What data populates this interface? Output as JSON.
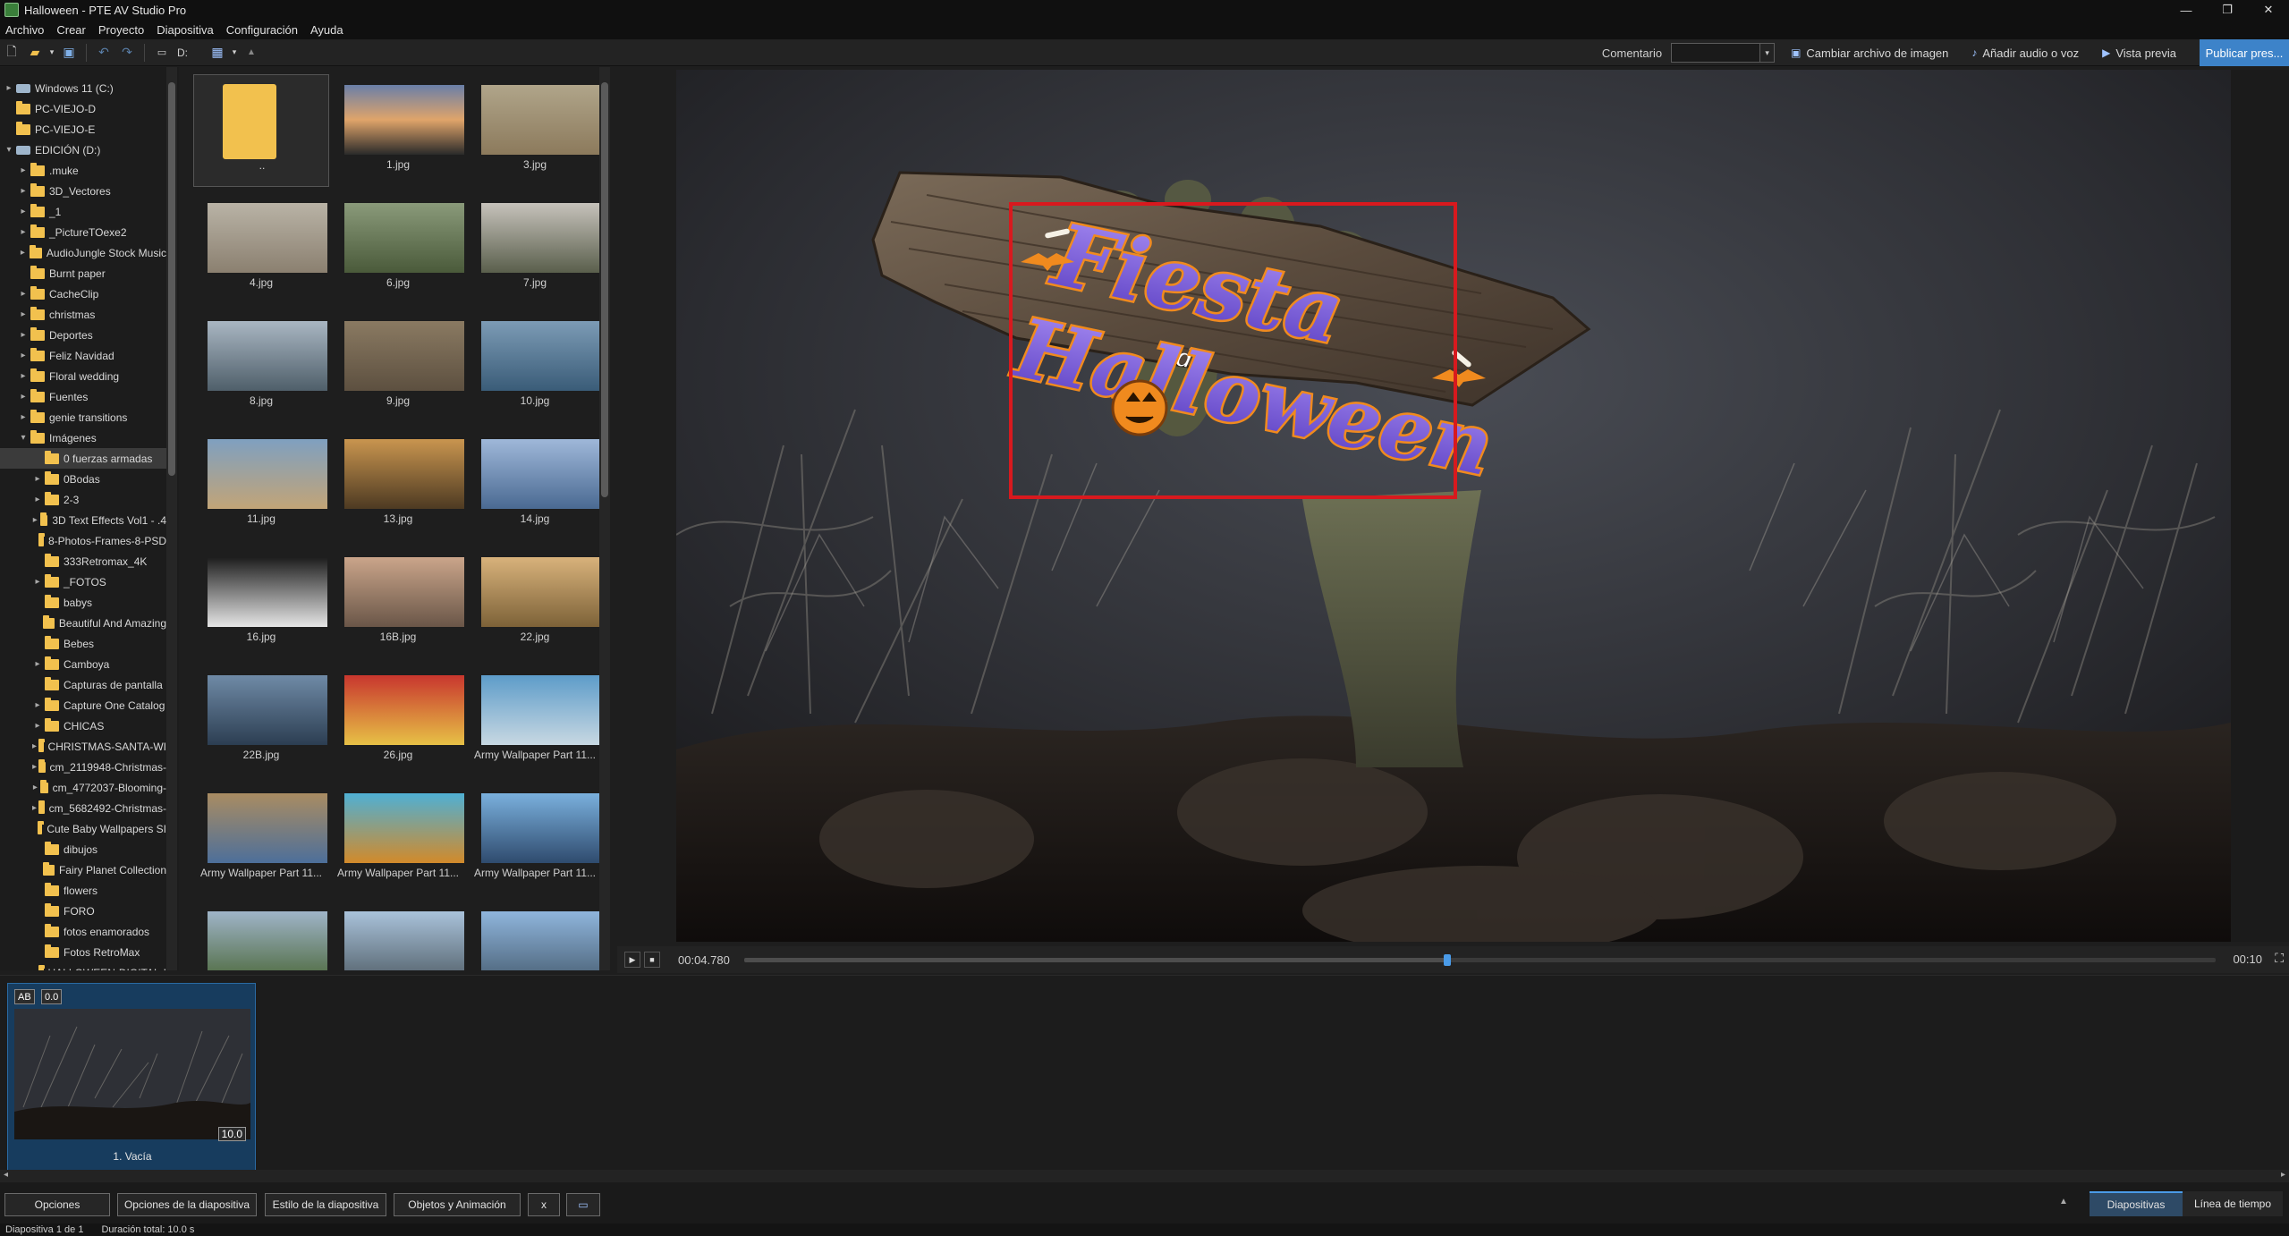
{
  "window": {
    "title": "Halloween - PTE AV Studio Pro"
  },
  "menu": [
    "Archivo",
    "Crear",
    "Proyecto",
    "Diapositiva",
    "Configuración",
    "Ayuda"
  ],
  "toolbar": {
    "drive_label": "D:",
    "comment_label": "Comentario",
    "comment_value": "",
    "change_image_label": "Cambiar archivo de imagen",
    "add_audio_label": "Añadir audio o voz",
    "preview_label": "Vista previa",
    "publish_label": "Publicar pres..."
  },
  "tree": [
    {
      "label": "Windows 11 (C:)",
      "type": "drive",
      "level": 0,
      "arrow": "▸"
    },
    {
      "label": "PC-VIEJO-D",
      "type": "folder",
      "level": 0,
      "arrow": ""
    },
    {
      "label": "PC-VIEJO-E",
      "type": "folder",
      "level": 0,
      "arrow": ""
    },
    {
      "label": "EDICIÓN (D:)",
      "type": "drive",
      "level": 0,
      "arrow": "▾"
    },
    {
      "label": ".muke",
      "type": "folder",
      "level": 1,
      "arrow": "▸"
    },
    {
      "label": "3D_Vectores",
      "type": "folder",
      "level": 1,
      "arrow": "▸"
    },
    {
      "label": "_1",
      "type": "folder",
      "level": 1,
      "arrow": "▸"
    },
    {
      "label": "_PictureTOexe2",
      "type": "folder",
      "level": 1,
      "arrow": "▸"
    },
    {
      "label": "AudioJungle Stock Music",
      "type": "folder",
      "level": 1,
      "arrow": "▸"
    },
    {
      "label": "Burnt paper",
      "type": "folder",
      "level": 1,
      "arrow": ""
    },
    {
      "label": "CacheClip",
      "type": "folder",
      "level": 1,
      "arrow": "▸"
    },
    {
      "label": "christmas",
      "type": "folder",
      "level": 1,
      "arrow": "▸"
    },
    {
      "label": "Deportes",
      "type": "folder",
      "level": 1,
      "arrow": "▸"
    },
    {
      "label": "Feliz Navidad",
      "type": "folder",
      "level": 1,
      "arrow": "▸"
    },
    {
      "label": "Floral wedding",
      "type": "folder",
      "level": 1,
      "arrow": "▸"
    },
    {
      "label": "Fuentes",
      "type": "folder",
      "level": 1,
      "arrow": "▸"
    },
    {
      "label": "genie transitions",
      "type": "folder",
      "level": 1,
      "arrow": "▸"
    },
    {
      "label": "Imágenes",
      "type": "folder",
      "level": 1,
      "arrow": "▾"
    },
    {
      "label": "0 fuerzas armadas",
      "type": "folder",
      "level": 2,
      "arrow": "",
      "selected": true
    },
    {
      "label": "0Bodas",
      "type": "folder",
      "level": 2,
      "arrow": "▸"
    },
    {
      "label": "2-3",
      "type": "folder",
      "level": 2,
      "arrow": "▸"
    },
    {
      "label": "3D Text Effects Vol1 - .4",
      "type": "folder",
      "level": 2,
      "arrow": "▸"
    },
    {
      "label": "8-Photos-Frames-8-PSD",
      "type": "folder",
      "level": 2,
      "arrow": ""
    },
    {
      "label": "333Retromax_4K",
      "type": "folder",
      "level": 2,
      "arrow": ""
    },
    {
      "label": "_FOTOS",
      "type": "folder",
      "level": 2,
      "arrow": "▸"
    },
    {
      "label": "babys",
      "type": "folder",
      "level": 2,
      "arrow": ""
    },
    {
      "label": "Beautiful And Amazing",
      "type": "folder",
      "level": 2,
      "arrow": ""
    },
    {
      "label": "Bebes",
      "type": "folder",
      "level": 2,
      "arrow": ""
    },
    {
      "label": "Camboya",
      "type": "folder",
      "level": 2,
      "arrow": "▸"
    },
    {
      "label": "Capturas de pantalla",
      "type": "folder",
      "level": 2,
      "arrow": ""
    },
    {
      "label": "Capture One Catalog",
      "type": "folder",
      "level": 2,
      "arrow": "▸"
    },
    {
      "label": "CHICAS",
      "type": "folder",
      "level": 2,
      "arrow": "▸"
    },
    {
      "label": "CHRISTMAS-SANTA-WI",
      "type": "folder",
      "level": 2,
      "arrow": "▸"
    },
    {
      "label": "cm_2119948-Christmas-",
      "type": "folder",
      "level": 2,
      "arrow": "▸"
    },
    {
      "label": "cm_4772037-Blooming-",
      "type": "folder",
      "level": 2,
      "arrow": "▸"
    },
    {
      "label": "cm_5682492-Christmas-",
      "type": "folder",
      "level": 2,
      "arrow": "▸"
    },
    {
      "label": "Cute Baby Wallpapers SI",
      "type": "folder",
      "level": 2,
      "arrow": ""
    },
    {
      "label": "dibujos",
      "type": "folder",
      "level": 2,
      "arrow": ""
    },
    {
      "label": "Fairy Planet Collection",
      "type": "folder",
      "level": 2,
      "arrow": ""
    },
    {
      "label": "flowers",
      "type": "folder",
      "level": 2,
      "arrow": ""
    },
    {
      "label": "FORO",
      "type": "folder",
      "level": 2,
      "arrow": ""
    },
    {
      "label": "fotos enamorados",
      "type": "folder",
      "level": 2,
      "arrow": ""
    },
    {
      "label": "Fotos RetroMax",
      "type": "folder",
      "level": 2,
      "arrow": ""
    },
    {
      "label": "HALLOWEEN-DIGITAL-I",
      "type": "folder",
      "level": 2,
      "arrow": "▸"
    }
  ],
  "thumbnails": [
    {
      "name": "..",
      "colors": [
        "#f2c14e",
        "#f2c14e"
      ],
      "folder": true
    },
    {
      "name": "1.jpg",
      "colors": [
        "#6a7fa8",
        "#e0a46a",
        "#2a2a2a"
      ]
    },
    {
      "name": "3.jpg",
      "colors": [
        "#b0a58a",
        "#8c7a5c"
      ]
    },
    {
      "name": "4.jpg",
      "colors": [
        "#b9b3a6",
        "#8b8070"
      ]
    },
    {
      "name": "6.jpg",
      "colors": [
        "#8a9a7a",
        "#4a5a3a"
      ]
    },
    {
      "name": "7.jpg",
      "colors": [
        "#c6c2bb",
        "#5a5f4c"
      ]
    },
    {
      "name": "8.jpg",
      "colors": [
        "#a9b6c2",
        "#4f5f6a"
      ]
    },
    {
      "name": "9.jpg",
      "colors": [
        "#8a7a62",
        "#5d5040"
      ]
    },
    {
      "name": "10.jpg",
      "colors": [
        "#7c9bb5",
        "#3a5c78"
      ]
    },
    {
      "name": "11.jpg",
      "colors": [
        "#7fa0c0",
        "#c2a477"
      ]
    },
    {
      "name": "13.jpg",
      "colors": [
        "#c9954f",
        "#4d3a22"
      ]
    },
    {
      "name": "14.jpg",
      "colors": [
        "#9fb8d9",
        "#4a6a92"
      ]
    },
    {
      "name": "16.jpg",
      "colors": [
        "#1d1d1d",
        "#e6e6e6"
      ]
    },
    {
      "name": "16B.jpg",
      "colors": [
        "#caa58a",
        "#6a5648"
      ]
    },
    {
      "name": "22.jpg",
      "colors": [
        "#d8b27b",
        "#7d6238"
      ]
    },
    {
      "name": "22B.jpg",
      "colors": [
        "#6f8aa6",
        "#2c3e52"
      ]
    },
    {
      "name": "26.jpg",
      "colors": [
        "#c8362e",
        "#e7c146"
      ]
    },
    {
      "name": "Army Wallpaper Part 11...",
      "colors": [
        "#5d9cc9",
        "#c8d8e2"
      ]
    },
    {
      "name": "Army Wallpaper Part 11...",
      "colors": [
        "#a98c62",
        "#4d6f9a"
      ]
    },
    {
      "name": "Army Wallpaper Part 11...",
      "colors": [
        "#4fb0d4",
        "#d28a2a"
      ]
    },
    {
      "name": "Army Wallpaper Part 11...",
      "colors": [
        "#7ab0dd",
        "#2f4b6e"
      ]
    },
    {
      "name": "",
      "colors": [
        "#9fb4c8",
        "#4e6a3e"
      ]
    },
    {
      "name": "",
      "colors": [
        "#a9c2da",
        "#54626c"
      ]
    },
    {
      "name": "",
      "colors": [
        "#8fb5dc",
        "#4b6277"
      ]
    }
  ],
  "playback": {
    "current_time": "00:04.780",
    "end_time": "00:10",
    "progress": 0.478
  },
  "slide": {
    "badge_ab": "AB",
    "badge_time": "0.0",
    "duration": "10.0",
    "name": "1. Vacía"
  },
  "bottom_buttons": {
    "options": "Opciones",
    "slide_options": "Opciones de la diapositiva",
    "slide_style": "Estilo de la diapositiva",
    "objects_animation": "Objetos y Animación",
    "x": "x"
  },
  "view_tabs": {
    "slides": "Diapositivas",
    "timeline": "Línea de tiempo"
  },
  "status": {
    "slide_count": "Diapositiva 1 de 1",
    "total_duration": "Duración total: 10.0 s"
  },
  "preview_logo": {
    "line1": "Fiesta",
    "line2": "de",
    "line3": "Halloween"
  },
  "colors": {
    "accent": "#4a9be8",
    "selection_box": "#d8191e",
    "logo_purple": "#7a5bd6",
    "logo_orange": "#f08a1e"
  }
}
